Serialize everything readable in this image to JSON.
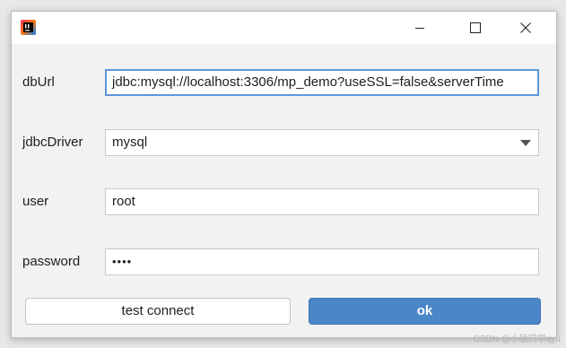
{
  "window": {
    "app_icon": "intellij-idea-icon",
    "controls": [
      "minimize-icon",
      "maximize-icon",
      "close-icon"
    ]
  },
  "form": {
    "dburl": {
      "label": "dbUrl",
      "value": "jdbc:mysql://localhost:3306/mp_demo?useSSL=false&serverTime"
    },
    "jdbc_driver": {
      "label": "jdbcDriver",
      "value": "mysql"
    },
    "user": {
      "label": "user",
      "value": "root"
    },
    "password": {
      "label": "password",
      "value": "••••"
    }
  },
  "buttons": {
    "test_connect": "test connect",
    "ok": "ok"
  },
  "watermark": "CSDN @小猛同学qyu",
  "colors": {
    "accent": "#4a86c8",
    "focus_border": "#5f97d6"
  }
}
